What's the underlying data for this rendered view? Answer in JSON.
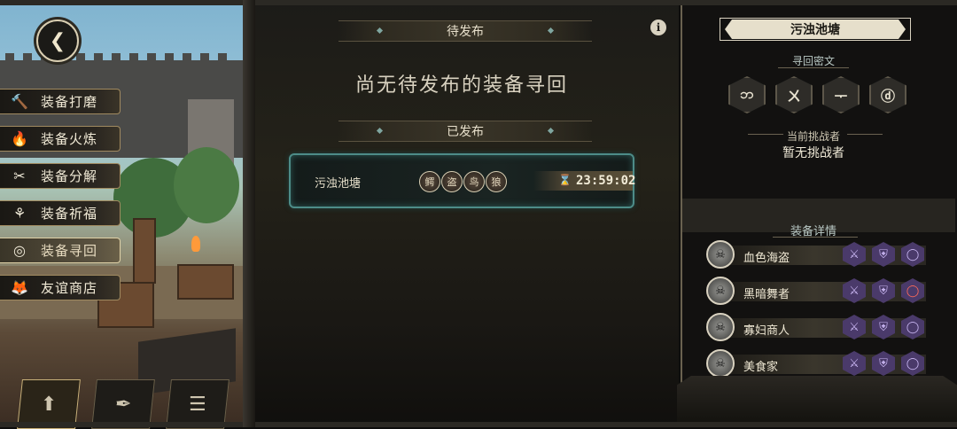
{
  "left_menu": {
    "items": [
      {
        "icon": "hammer-icon",
        "glyph": "🔨",
        "label": "装备打磨",
        "active": false
      },
      {
        "icon": "flame-icon",
        "glyph": "🔥",
        "label": "装备火炼",
        "active": false
      },
      {
        "icon": "disassemble-icon",
        "glyph": "✂",
        "label": "装备分解",
        "active": false
      },
      {
        "icon": "blessing-icon",
        "glyph": "⚘",
        "label": "装备祈福",
        "active": false
      },
      {
        "icon": "target-icon",
        "glyph": "◎",
        "label": "装备寻回",
        "active": true
      },
      {
        "icon": "fox-icon",
        "glyph": "🦊",
        "label": "友谊商店",
        "active": false
      }
    ]
  },
  "center": {
    "pending_title": "待发布",
    "empty_message": "尚无待发布的装备寻回",
    "published_title": "已发布",
    "entry": {
      "name": "污浊池塘",
      "avatars": [
        "鳄",
        "盗",
        "鸟",
        "狼"
      ],
      "timer": "23:59:02"
    }
  },
  "right_panel": {
    "title": "污浊池塘",
    "rune_title": "寻回密文",
    "runes": [
      "ဘ",
      "ㄨ",
      "ᅮ",
      "ⓓ"
    ],
    "challenger_label": "当前挑战者",
    "challenger_value": "暂无挑战者",
    "detail_title": "装备详情",
    "characters": [
      {
        "name": "血色海盗",
        "ring_red": false
      },
      {
        "name": "黑暗舞者",
        "ring_red": true
      },
      {
        "name": "寡妇商人",
        "ring_red": false
      },
      {
        "name": "美食家",
        "ring_red": false
      }
    ]
  },
  "colors": {
    "accent_teal": "#4d8c88",
    "gear_purple": "#4a3a6a",
    "gold_border": "#a08a60"
  }
}
